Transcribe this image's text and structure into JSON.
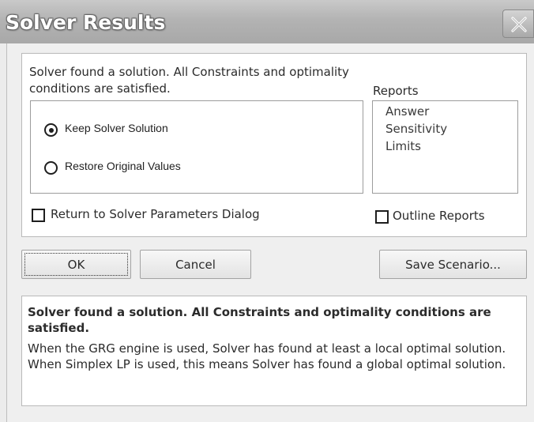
{
  "window": {
    "title": "Solver Results",
    "close_icon": "close-icon"
  },
  "status": {
    "line1": "Solver found a solution.  All Constraints and optimality",
    "line2": "conditions are satisfied."
  },
  "options": {
    "keep_solution": {
      "label": "Keep Solver Solution",
      "selected": true
    },
    "restore_values": {
      "label": "Restore Original Values",
      "selected": false
    }
  },
  "reports": {
    "label": "Reports",
    "items": [
      "Answer",
      "Sensitivity",
      "Limits"
    ]
  },
  "checkboxes": {
    "return_to_params": {
      "label": "Return to Solver Parameters Dialog",
      "checked": false
    },
    "outline_reports": {
      "label": "Outline Reports",
      "checked": false
    }
  },
  "buttons": {
    "ok": "OK",
    "cancel": "Cancel",
    "save_scenario": "Save Scenario..."
  },
  "description": {
    "heading": "Solver found a solution.  All Constraints and optimality conditions are satisfied.",
    "body": "When the GRG engine is used, Solver has found at least a local optimal solution. When Simplex LP is used, this means Solver has found a global optimal solution."
  }
}
